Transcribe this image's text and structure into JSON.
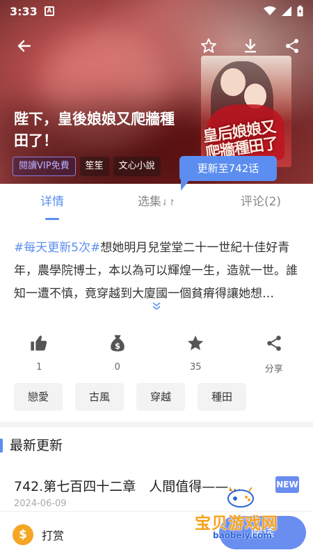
{
  "status_bar": {
    "time": "3:33",
    "notification_icon": "A"
  },
  "book": {
    "title": "陛下，皇後娘娘又爬牆種田了！",
    "tags": [
      "閱讀VIP免費",
      "笙笙",
      "文心小說"
    ],
    "update_badge": "更新至742话",
    "cover_text": "皇后娘娘又爬牆種田了"
  },
  "tabs": [
    {
      "label": "详情",
      "active": true
    },
    {
      "label": "选集",
      "sort_icon": "⇃↾",
      "active": false
    },
    {
      "label": "评论(2)",
      "active": false
    }
  ],
  "synopsis": {
    "hashtag": "#每天更新5次#",
    "text": "想她明月兒堂堂二十一世紀十佳好青年，農學院博士，本以為可以輝煌一生，造就一世。誰知一遭不慎，竟穿越到大廈國一個貧瘠得讓她想…"
  },
  "actions": [
    {
      "icon": "thumbs-up-icon",
      "count": "1"
    },
    {
      "icon": "money-bag-icon",
      "count": "0"
    },
    {
      "icon": "star-icon",
      "count": "35"
    },
    {
      "icon": "share-icon",
      "count": "分享"
    }
  ],
  "genres": [
    "戀愛",
    "古風",
    "穿越",
    "種田"
  ],
  "latest": {
    "heading": "最新更新",
    "chapter_title": "742.第七百四十二章　人間值得——…",
    "new_badge": "NEW",
    "date": "2024-06-09"
  },
  "bottom": {
    "reward_label": "打赏",
    "reward_coin": "$",
    "read_label": "阅读"
  },
  "watermark": {
    "text": "宝贝游戏网",
    "url": "baobeiy.com"
  },
  "colors": {
    "accent": "#5b8ef0",
    "coin": "#f5a623"
  }
}
